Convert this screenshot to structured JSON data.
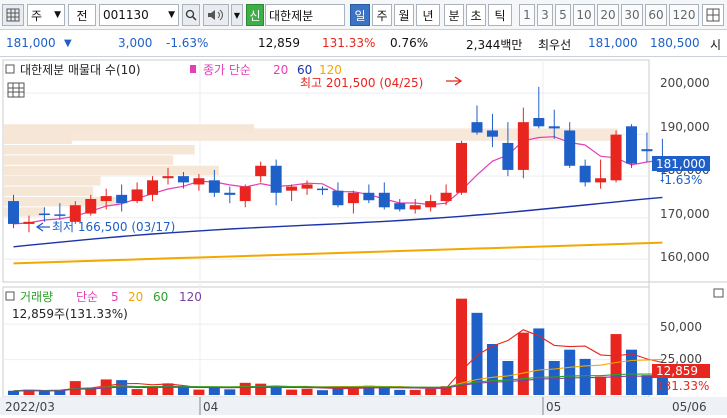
{
  "toolbar": {
    "icon_label": "",
    "market_select": "주",
    "code_prefix": "전",
    "stock_code": "001130",
    "sin_label": "신",
    "stock_name": "대한제분",
    "period_tabs": [
      "일",
      "주",
      "월",
      "년",
      "분",
      "초",
      "틱"
    ],
    "active_period": "일",
    "interval_buttons": [
      "1",
      "3",
      "5",
      "10",
      "20",
      "30",
      "60",
      "120"
    ]
  },
  "info": {
    "price": "181,000",
    "change": "3,000",
    "change_pct": "-1.63%",
    "volume": "12,859",
    "volume_ratio": "131.33%",
    "turnover_pct": "0.76%",
    "amount": "2,344백만",
    "best_label": "최우선",
    "ask": "181,000",
    "bid": "180,500",
    "trailing": "시"
  },
  "price_panel": {
    "legend_name": "대한제분 매물대 수(10)",
    "legend_close": "종가 단순",
    "ma_periods": [
      "20",
      "60",
      "120"
    ],
    "high_label": "최고 201,500 (04/25)",
    "low_label": "최저 166,500 (03/17)",
    "current_price_label": "181,000",
    "current_pct_label": "-1.63%",
    "y_ticks": [
      "200,000",
      "190,000",
      "180,000",
      "170,000",
      "160,000"
    ]
  },
  "volume_panel": {
    "legend_name": "거래량",
    "legend_simple": "단순",
    "ma_periods": [
      "5",
      "20",
      "60",
      "120"
    ],
    "current_line": "12,859주(131.33%)",
    "current_label": "12,859",
    "current_pct_label": "131.33%",
    "y_ticks": [
      "50,000",
      "25,000"
    ]
  },
  "x_axis": {
    "labels": [
      "2022/03",
      "04",
      "05",
      "05/06"
    ]
  },
  "colors": {
    "up": "#e8251f",
    "down": "#1e5fc8",
    "ma5": "#e33fb8",
    "ma20": "#f2a800",
    "ma60": "#1b33a6",
    "ma120": "#f2a800",
    "vol_ma5": "#e8251f",
    "vol_ma20": "#f2a800",
    "vol_ma60": "#2ba02b",
    "vol_ma120": "#7b3fa0"
  },
  "chart_data": {
    "type": "candlestick",
    "price_range": [
      155000,
      207000
    ],
    "volume_range": [
      0,
      72000
    ],
    "candles": [
      {
        "o": 174000,
        "h": 175500,
        "l": 167500,
        "c": 168500,
        "v": 3000
      },
      {
        "o": 168500,
        "h": 170500,
        "l": 166500,
        "c": 169000,
        "v": 3800
      },
      {
        "o": 171000,
        "h": 172500,
        "l": 169000,
        "c": 170800,
        "v": 2800
      },
      {
        "o": 170800,
        "h": 173500,
        "l": 169500,
        "c": 170500,
        "v": 3600
      },
      {
        "o": 169000,
        "h": 174000,
        "l": 168500,
        "c": 173000,
        "v": 9800
      },
      {
        "o": 171000,
        "h": 175500,
        "l": 170500,
        "c": 174500,
        "v": 5000
      },
      {
        "o": 174000,
        "h": 177000,
        "l": 172000,
        "c": 175200,
        "v": 11000
      },
      {
        "o": 175500,
        "h": 178000,
        "l": 171500,
        "c": 173500,
        "v": 10500
      },
      {
        "o": 174000,
        "h": 178500,
        "l": 173500,
        "c": 176800,
        "v": 4200
      },
      {
        "o": 175500,
        "h": 180000,
        "l": 174000,
        "c": 179000,
        "v": 5200
      },
      {
        "o": 179500,
        "h": 182000,
        "l": 178000,
        "c": 180000,
        "v": 8200
      },
      {
        "o": 180000,
        "h": 181000,
        "l": 177000,
        "c": 178500,
        "v": 5200
      },
      {
        "o": 178000,
        "h": 180500,
        "l": 176500,
        "c": 179500,
        "v": 3800
      },
      {
        "o": 179000,
        "h": 181500,
        "l": 175000,
        "c": 176000,
        "v": 5400
      },
      {
        "o": 176000,
        "h": 177500,
        "l": 173500,
        "c": 175500,
        "v": 4000
      },
      {
        "o": 174000,
        "h": 178000,
        "l": 172500,
        "c": 177500,
        "v": 8600
      },
      {
        "o": 180000,
        "h": 183500,
        "l": 178500,
        "c": 182500,
        "v": 8000
      },
      {
        "o": 182500,
        "h": 184000,
        "l": 173000,
        "c": 176000,
        "v": 5600
      },
      {
        "o": 176500,
        "h": 178000,
        "l": 174000,
        "c": 177500,
        "v": 3800
      },
      {
        "o": 177000,
        "h": 179000,
        "l": 175500,
        "c": 178000,
        "v": 4400
      },
      {
        "o": 177000,
        "h": 177500,
        "l": 175500,
        "c": 176800,
        "v": 3400
      },
      {
        "o": 176500,
        "h": 178500,
        "l": 172500,
        "c": 173000,
        "v": 5600
      },
      {
        "o": 173500,
        "h": 176500,
        "l": 171000,
        "c": 176000,
        "v": 5400
      },
      {
        "o": 176000,
        "h": 178000,
        "l": 173500,
        "c": 174200,
        "v": 6600
      },
      {
        "o": 176000,
        "h": 178500,
        "l": 172000,
        "c": 172500,
        "v": 5400
      },
      {
        "o": 173500,
        "h": 174500,
        "l": 171500,
        "c": 172000,
        "v": 3600
      },
      {
        "o": 172000,
        "h": 174500,
        "l": 171000,
        "c": 173000,
        "v": 3600
      },
      {
        "o": 172500,
        "h": 175500,
        "l": 171500,
        "c": 174000,
        "v": 4400
      },
      {
        "o": 174000,
        "h": 178000,
        "l": 173000,
        "c": 176000,
        "v": 6200
      },
      {
        "o": 176000,
        "h": 188500,
        "l": 175500,
        "c": 188000,
        "v": 68000
      },
      {
        "o": 193000,
        "h": 197000,
        "l": 190000,
        "c": 190500,
        "v": 58000
      },
      {
        "o": 191000,
        "h": 195000,
        "l": 187000,
        "c": 189500,
        "v": 36000
      },
      {
        "o": 188000,
        "h": 193000,
        "l": 180000,
        "c": 181500,
        "v": 24000
      },
      {
        "o": 181500,
        "h": 196500,
        "l": 179500,
        "c": 193000,
        "v": 44000
      },
      {
        "o": 194000,
        "h": 201500,
        "l": 191500,
        "c": 192000,
        "v": 47000
      },
      {
        "o": 192000,
        "h": 196000,
        "l": 189000,
        "c": 191500,
        "v": 24000
      },
      {
        "o": 191000,
        "h": 193000,
        "l": 182000,
        "c": 182500,
        "v": 32000
      },
      {
        "o": 182500,
        "h": 184000,
        "l": 177500,
        "c": 178500,
        "v": 25500
      },
      {
        "o": 178500,
        "h": 184000,
        "l": 177000,
        "c": 179500,
        "v": 13000
      },
      {
        "o": 179000,
        "h": 191000,
        "l": 178500,
        "c": 190000,
        "v": 43000
      },
      {
        "o": 192000,
        "h": 192500,
        "l": 182000,
        "c": 183000,
        "v": 32000
      },
      {
        "o": 186500,
        "h": 190500,
        "l": 183500,
        "c": 186000,
        "v": 14000
      },
      {
        "o": 184000,
        "h": 189000,
        "l": 178500,
        "c": 181000,
        "v": 12859
      }
    ]
  }
}
